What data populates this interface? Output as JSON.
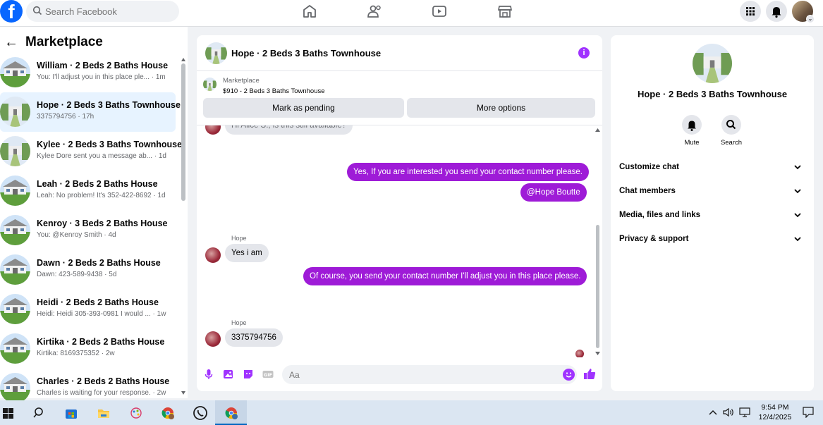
{
  "topbar": {
    "logo": "f",
    "search_placeholder": "Search Facebook",
    "icons": [
      "home-icon",
      "friends-icon",
      "video-icon",
      "marketplace-icon"
    ],
    "right_icons": [
      "menu-grid-icon",
      "notifications-icon",
      "profile-avatar"
    ]
  },
  "left": {
    "back_glyph": "←",
    "title": "Marketplace",
    "conversations": [
      {
        "name": "William · 2 Beds 2 Baths House",
        "preview": "You: I'll adjust you in this place ple... · 1m"
      },
      {
        "name": "Hope · 2 Beds 3 Baths Townhouse",
        "preview": "3375794756 · 17h"
      },
      {
        "name": "Kylee · 2 Beds 3 Baths Townhouse",
        "preview": "Kylee Dore sent you a message ab... · 1d"
      },
      {
        "name": "Leah · 2 Beds 2 Baths House",
        "preview": "Leah: No problem! It's 352-422-8692 · 1d"
      },
      {
        "name": "Kenroy · 3 Beds 2 Baths House",
        "preview": "You: @Kenroy Smith · 4d"
      },
      {
        "name": "Dawn · 2 Beds 2 Baths House",
        "preview": "Dawn: 423-589-9438 · 5d"
      },
      {
        "name": "Heidi · 2 Beds 2 Baths House",
        "preview": "Heidi: Heidi 305-393-0981 I would ... · 1w"
      },
      {
        "name": "Kirtika · 2 Beds 2 Baths House",
        "preview": "Kirtika: 8169375352 · 2w"
      },
      {
        "name": "Charles · 2 Beds 2 Baths House",
        "preview": "Charles is waiting for your response. · 2w"
      }
    ]
  },
  "chat": {
    "title": "Hope · 2 Beds 3 Baths Townhouse",
    "info_glyph": "i",
    "listing_source": "Marketplace",
    "listing_price": "$910 - 2 Beds 3 Baths Townhouse",
    "mark_pending": "Mark as pending",
    "more_options": "More options",
    "partial_top_message": "Hi Alice S., is this still available?",
    "messages": {
      "out1": "Yes, If you are interested you send your contact number please.",
      "out2": "@Hope Boutte",
      "sender1": "Hope",
      "in1": "Yes i am",
      "out3": "Of course, you send your contact number I'll adjust you in this place please.",
      "sender2": "Hope",
      "in2": "3375794756"
    },
    "composer_placeholder": "Aa"
  },
  "right": {
    "title": "Hope · 2 Beds 3 Baths Townhouse",
    "mute_label": "Mute",
    "search_label": "Search",
    "rows": [
      "Customize chat",
      "Chat members",
      "Media, files and links",
      "Privacy & support"
    ]
  },
  "taskbar": {
    "time": "9:54 PM",
    "date": "12/4/2025"
  },
  "colors": {
    "accent": "#0866ff",
    "bubble_out": "#9e1bd7",
    "info": "#a033ff"
  }
}
